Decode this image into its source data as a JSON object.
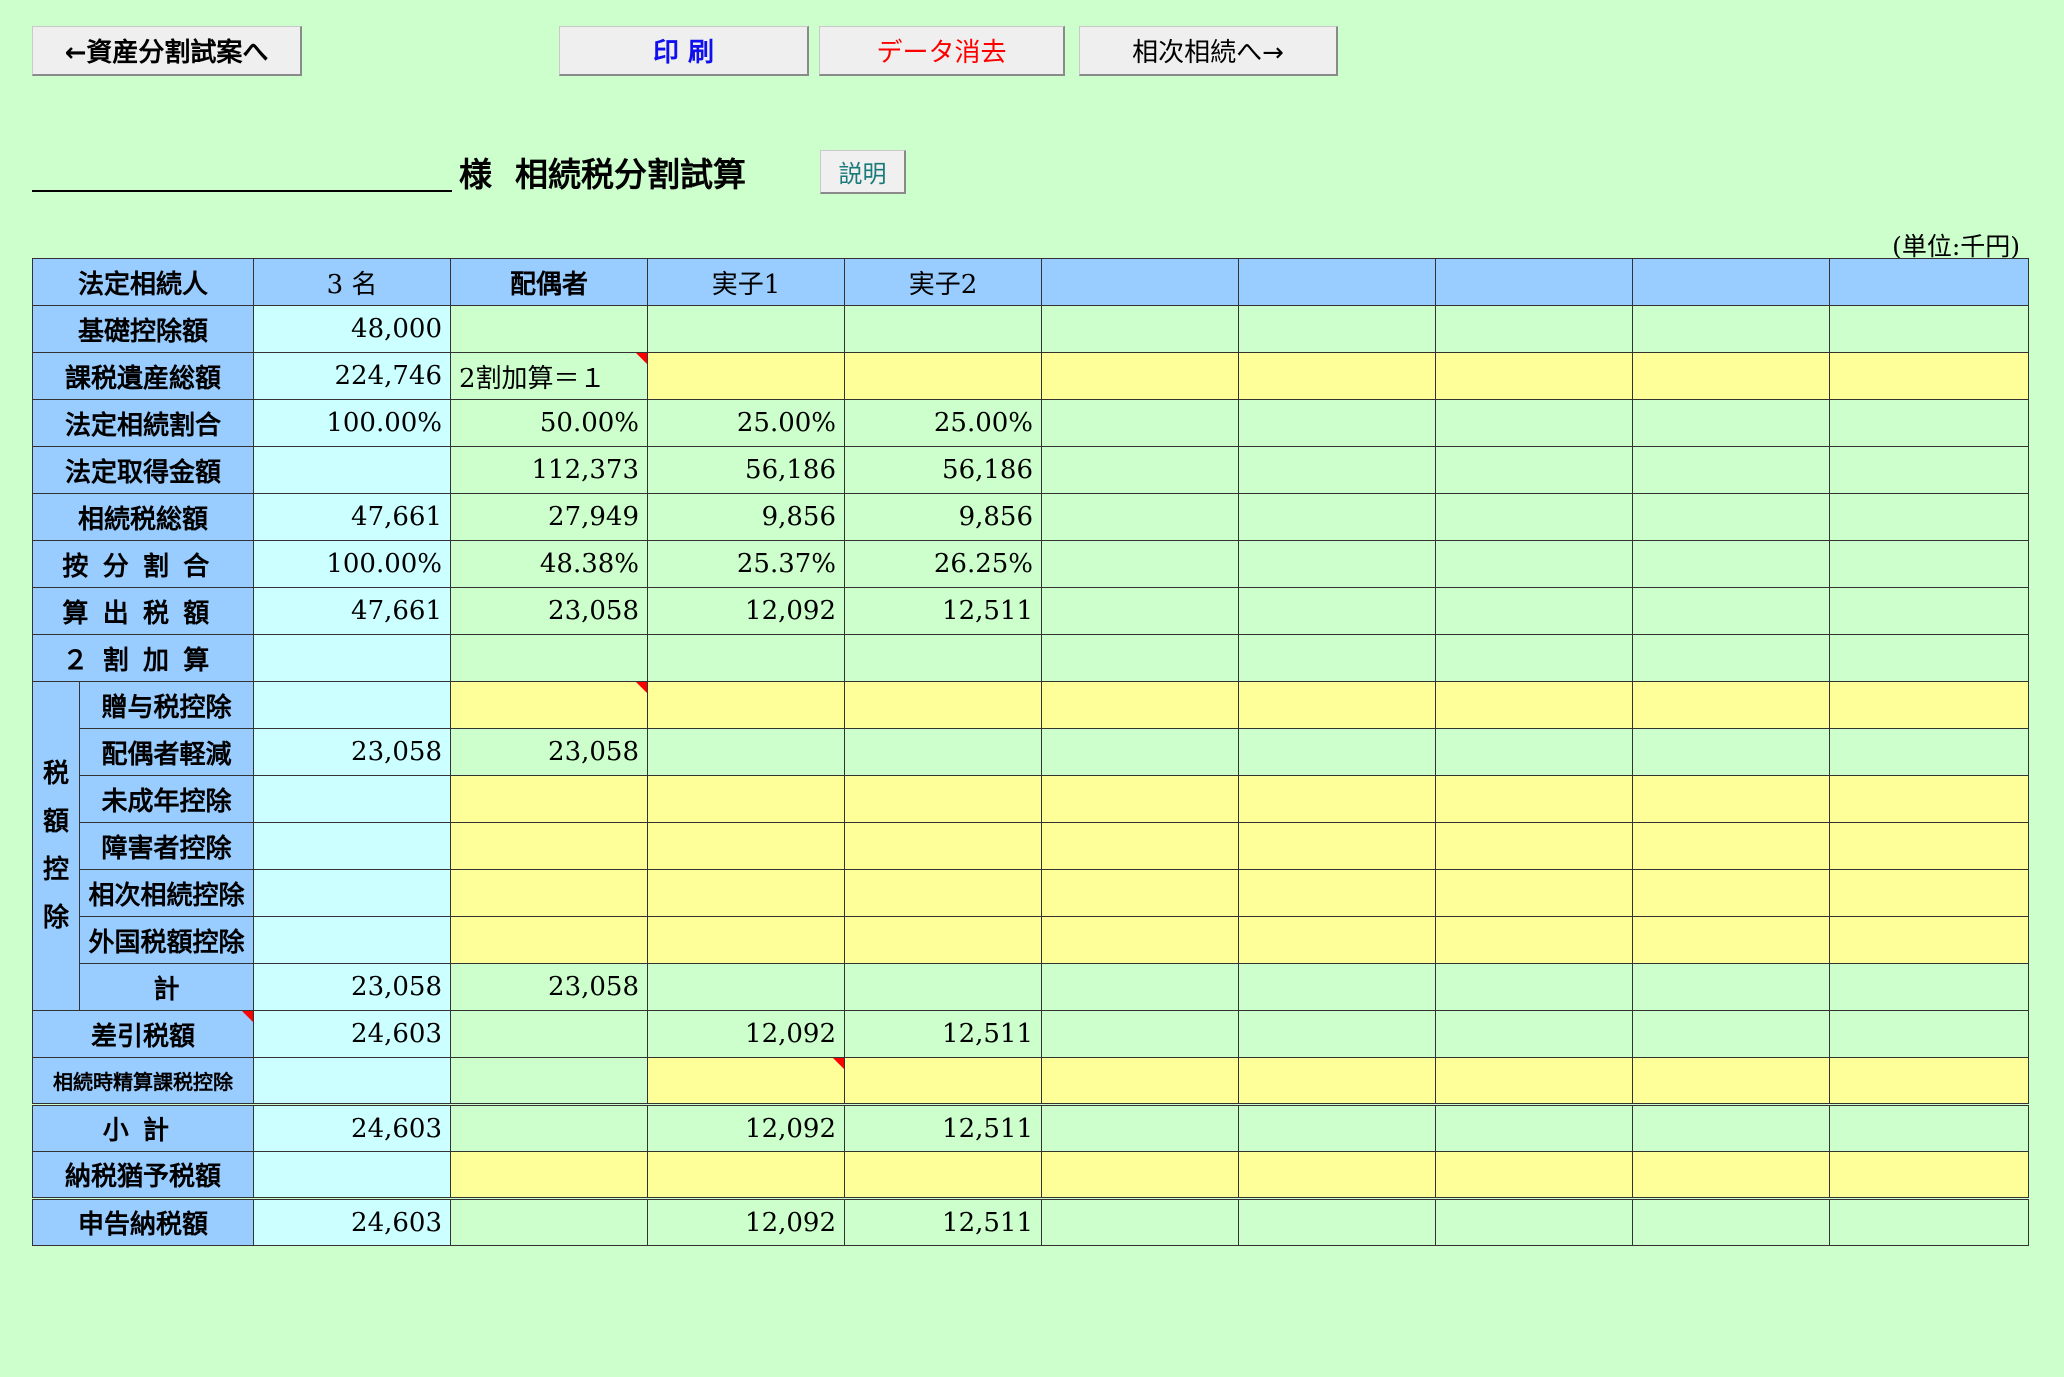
{
  "toolbar": {
    "back_label": "←資産分割試案へ",
    "print_label": "印 刷",
    "clear_label": "データ消去",
    "next_label": "相次相続へ→"
  },
  "heading": {
    "title": "様  相続税分割試算",
    "help_label": "説明",
    "unit": "(単位:千円)"
  },
  "colors": {
    "page_bg": "#ccffcc",
    "label_bg": "#99ccff",
    "total_bg": "#ccffff",
    "input_bg": "#ffff99",
    "flag": "#ff0000"
  },
  "table": {
    "header": {
      "label": "法定相続人",
      "count": "3 名",
      "heirs": [
        "配偶者",
        "実子1",
        "実子2",
        "",
        "",
        "",
        "",
        ""
      ]
    },
    "rows": {
      "basic_deduction": {
        "label": "基礎控除額",
        "total": "48,000",
        "cells": [
          "",
          "",
          "",
          "",
          "",
          "",
          "",
          ""
        ]
      },
      "taxable_estate": {
        "label": "課税遺産総額",
        "total": "224,746",
        "cells": [
          "2割加算＝１",
          "",
          "",
          "",
          "",
          "",
          "",
          ""
        ]
      },
      "statutory_ratio": {
        "label": "法定相続割合",
        "total": "100.00%",
        "cells": [
          "50.00%",
          "25.00%",
          "25.00%",
          "",
          "",
          "",
          "",
          ""
        ]
      },
      "statutory_amount": {
        "label": "法定取得金額",
        "total": "",
        "cells": [
          "112,373",
          "56,186",
          "56,186",
          "",
          "",
          "",
          "",
          ""
        ]
      },
      "total_tax": {
        "label": "相続税総額",
        "total": "47,661",
        "cells": [
          "27,949",
          "9,856",
          "9,856",
          "",
          "",
          "",
          "",
          ""
        ]
      },
      "allocation_ratio": {
        "label": "按分割合",
        "total": "100.00%",
        "cells": [
          "48.38%",
          "25.37%",
          "26.25%",
          "",
          "",
          "",
          "",
          ""
        ]
      },
      "computed_tax": {
        "label": "算出税額",
        "total": "47,661",
        "cells": [
          "23,058",
          "12,092",
          "12,511",
          "",
          "",
          "",
          "",
          ""
        ]
      },
      "surcharge": {
        "label": "２割加算",
        "total": "",
        "cells": [
          "",
          "",
          "",
          "",
          "",
          "",
          "",
          ""
        ]
      }
    },
    "deduction_group_label": [
      "税",
      "額",
      "控",
      "除"
    ],
    "deductions": [
      {
        "label": "贈与税控除",
        "total": "",
        "cells": [
          "",
          "",
          "",
          "",
          "",
          "",
          "",
          ""
        ]
      },
      {
        "label": "配偶者軽減",
        "total": "23,058",
        "cells": [
          "23,058",
          "",
          "",
          "",
          "",
          "",
          "",
          ""
        ]
      },
      {
        "label": "未成年控除",
        "total": "",
        "cells": [
          "",
          "",
          "",
          "",
          "",
          "",
          "",
          ""
        ]
      },
      {
        "label": "障害者控除",
        "total": "",
        "cells": [
          "",
          "",
          "",
          "",
          "",
          "",
          "",
          ""
        ]
      },
      {
        "label": "相次相続控除",
        "total": "",
        "cells": [
          "",
          "",
          "",
          "",
          "",
          "",
          "",
          ""
        ]
      },
      {
        "label": "外国税額控除",
        "total": "",
        "cells": [
          "",
          "",
          "",
          "",
          "",
          "",
          "",
          ""
        ]
      },
      {
        "label": "計",
        "total": "23,058",
        "cells": [
          "23,058",
          "",
          "",
          "",
          "",
          "",
          "",
          ""
        ]
      }
    ],
    "bottom": {
      "net_tax": {
        "label": "差引税額",
        "total": "24,603",
        "cells": [
          "",
          "12,092",
          "12,511",
          "",
          "",
          "",
          "",
          ""
        ]
      },
      "settlement_deduction": {
        "label": "相続時精算課税控除",
        "total": "",
        "cells": [
          "",
          "",
          "",
          "",
          "",
          "",
          "",
          ""
        ]
      },
      "subtotal": {
        "label": "小計",
        "total": "24,603",
        "cells": [
          "",
          "12,092",
          "12,511",
          "",
          "",
          "",
          "",
          ""
        ]
      },
      "deferred_tax": {
        "label": "納税猶予税額",
        "total": "",
        "cells": [
          "",
          "",
          "",
          "",
          "",
          "",
          "",
          ""
        ]
      },
      "declared_tax": {
        "label": "申告納税額",
        "total": "24,603",
        "cells": [
          "",
          "12,092",
          "12,511",
          "",
          "",
          "",
          "",
          ""
        ]
      }
    }
  }
}
